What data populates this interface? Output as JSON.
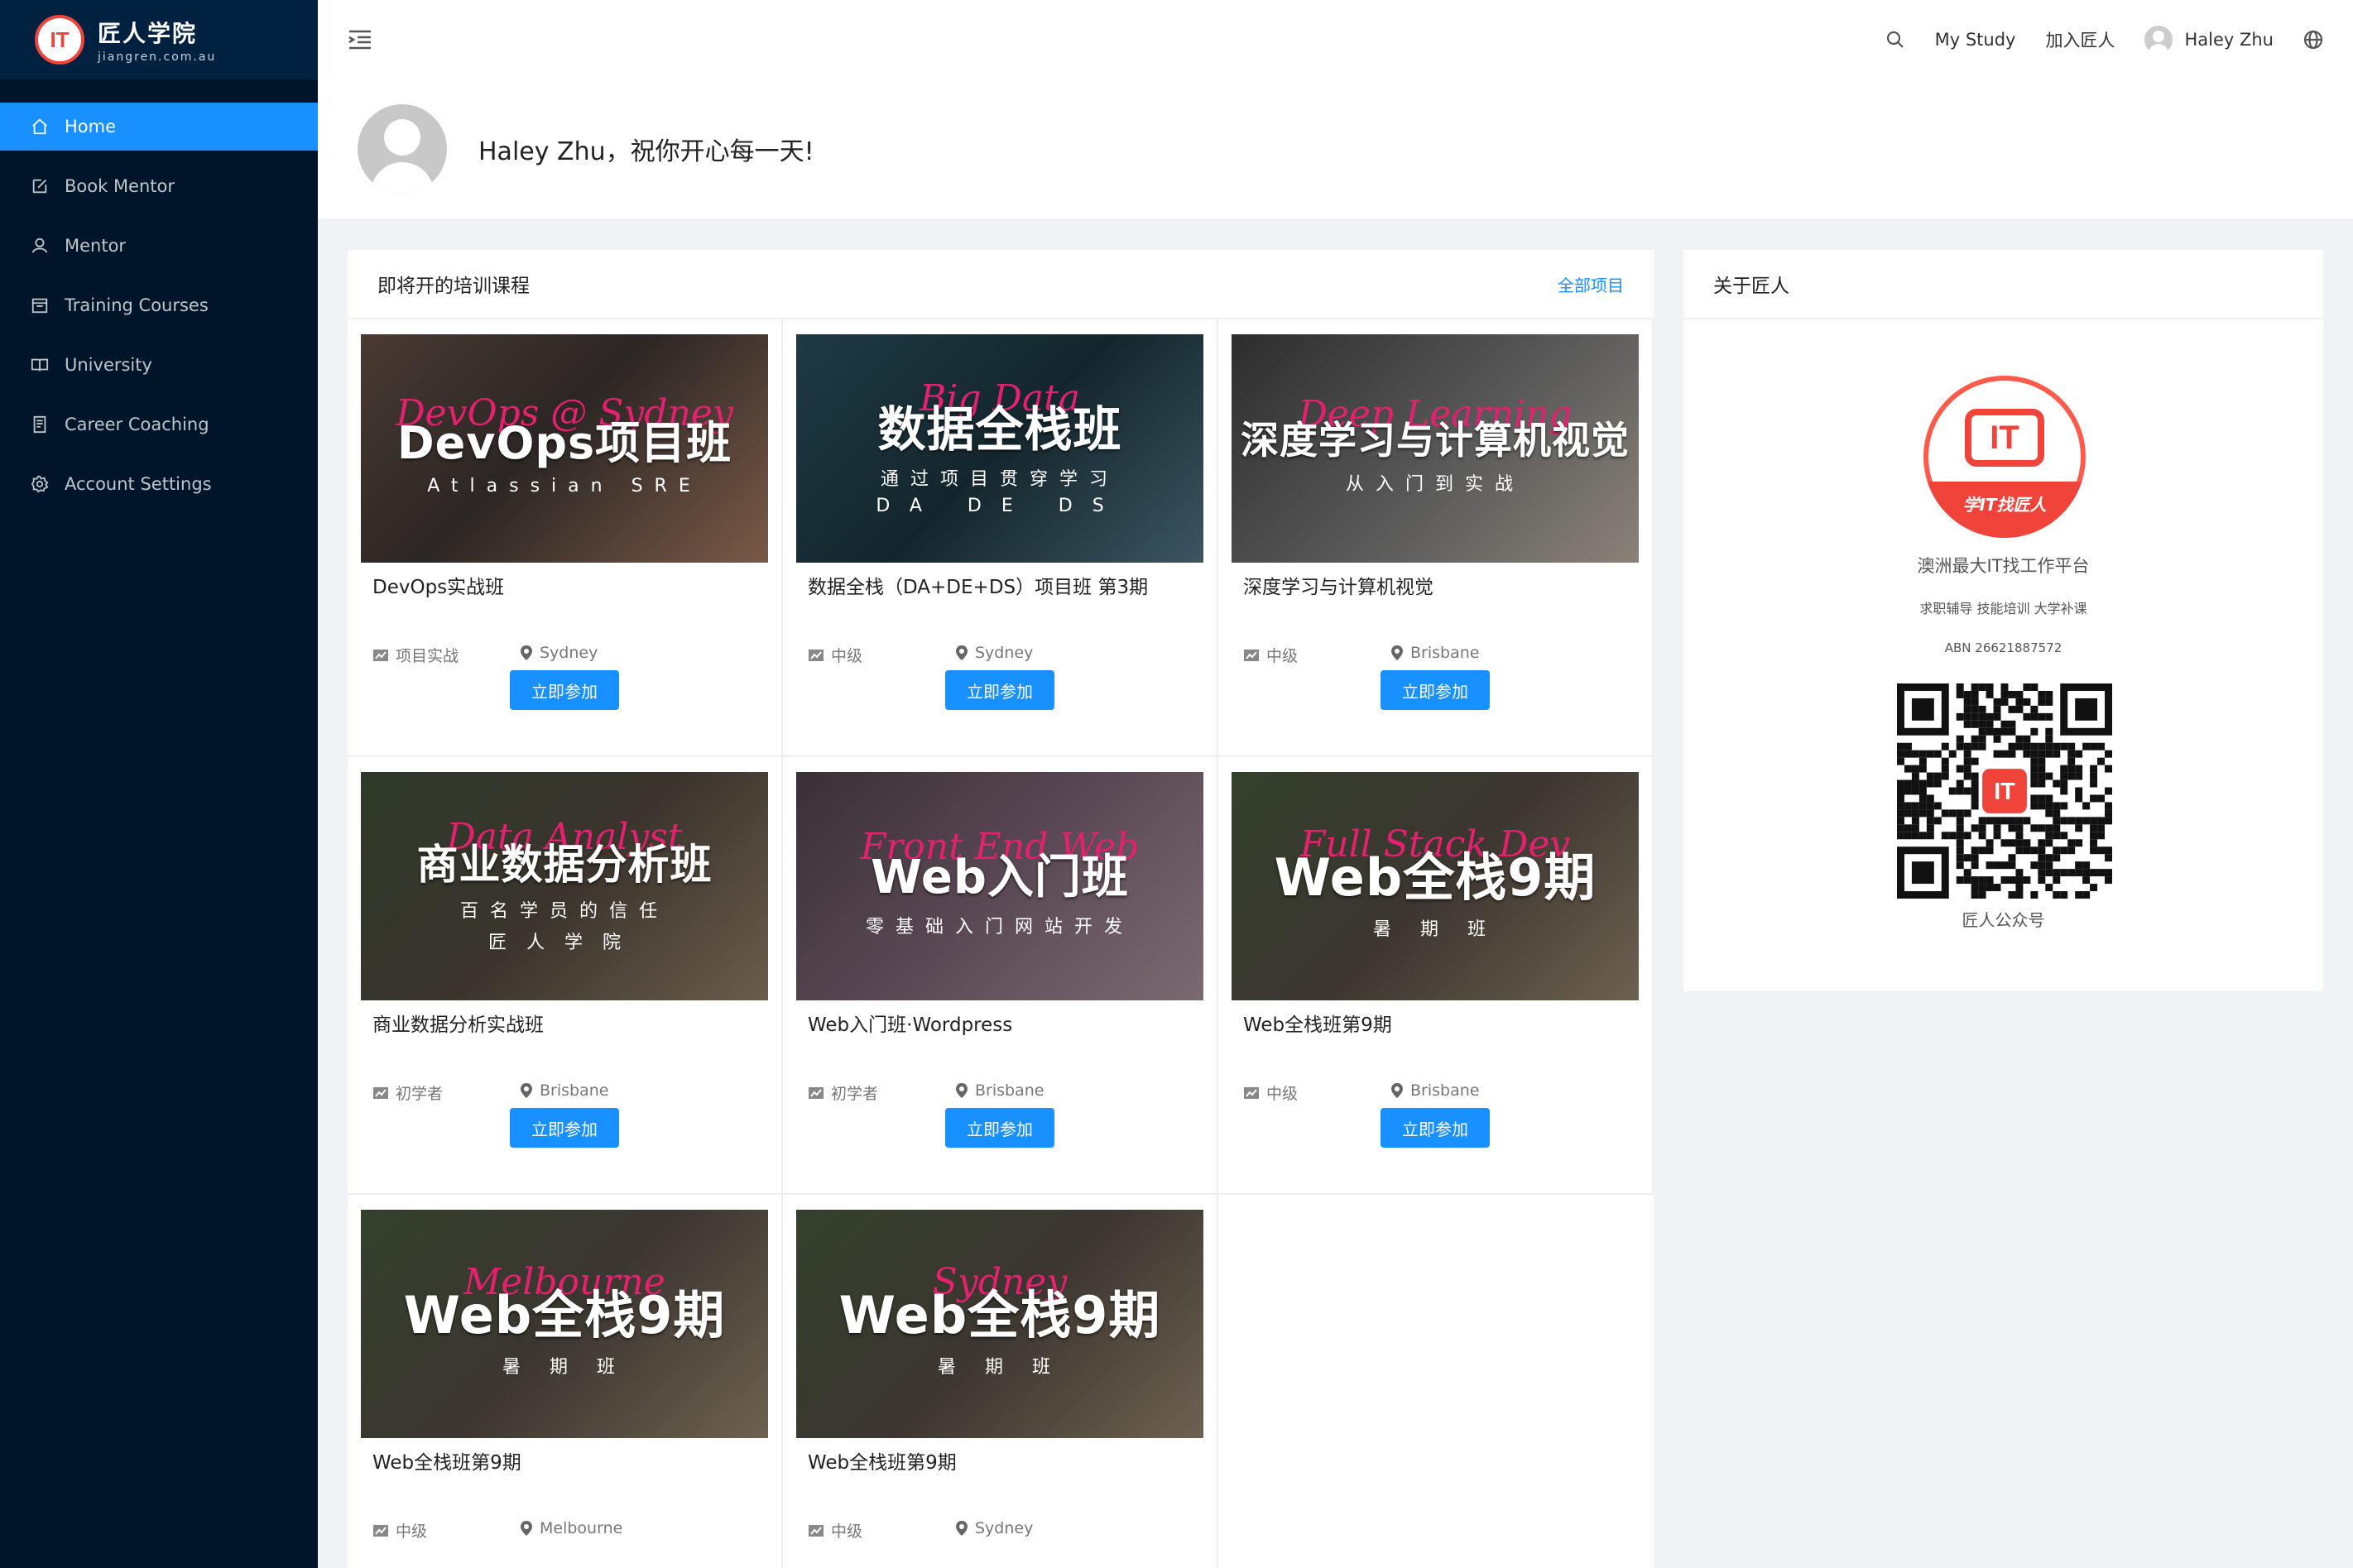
{
  "sidebar": {
    "logo_badge": "IT",
    "logo_title": "匠人学院",
    "logo_sub": "jiangren.com.au",
    "items": [
      {
        "label": "Home",
        "icon": "home-icon",
        "active": true
      },
      {
        "label": "Book Mentor",
        "icon": "edit-icon"
      },
      {
        "label": "Mentor",
        "icon": "user-icon"
      },
      {
        "label": "Training Courses",
        "icon": "calendar-icon"
      },
      {
        "label": "University",
        "icon": "book-icon"
      },
      {
        "label": "Career Coaching",
        "icon": "file-icon"
      },
      {
        "label": "Account Settings",
        "icon": "gear-icon"
      }
    ]
  },
  "header": {
    "my_study": "My Study",
    "join": "加入匠人",
    "user_name": "Haley Zhu"
  },
  "welcome": {
    "text": "Haley Zhu，祝你开心每一天!"
  },
  "courses": {
    "title": "即将开的培训课程",
    "all_link": "全部项目",
    "join_label": "立即参加",
    "items": [
      {
        "title": "DevOps实战班",
        "level": "项目实战",
        "city": "Sydney",
        "img_script": "DevOps @ Sydney",
        "img_big": "DevOps项目班",
        "img_sub": "Atlassian SRE",
        "img_sub2": ""
      },
      {
        "title": "数据全栈（DA+DE+DS）项目班 第3期",
        "level": "中级",
        "city": "Sydney",
        "img_script": "Big Data",
        "img_big": "数据全栈班",
        "img_sub": "通过项目贯穿学习",
        "img_sub2": "DA DE DS"
      },
      {
        "title": "深度学习与计算机视觉",
        "level": "中级",
        "city": "Brisbane",
        "img_script": "Deep Learning",
        "img_big": "深度学习与计算机视觉",
        "img_sub": "从入门到实战",
        "img_sub2": ""
      },
      {
        "title": "商业数据分析实战班",
        "level": "初学者",
        "city": "Brisbane",
        "img_script": "Data Analyst",
        "img_big": "商业数据分析班",
        "img_sub": "百名学员的信任",
        "img_sub2": "匠人学院"
      },
      {
        "title": "Web入门班·Wordpress",
        "level": "初学者",
        "city": "Brisbane",
        "img_script": "Front End Web",
        "img_big": "Web入门班",
        "img_sub": "零基础入门网站开发",
        "img_sub2": ""
      },
      {
        "title": "Web全栈班第9期",
        "level": "中级",
        "city": "Brisbane",
        "img_script": "Full Stack Dev",
        "img_big": "Web全栈9期",
        "img_sub": "暑 期 班",
        "img_sub2": ""
      },
      {
        "title": "Web全栈班第9期",
        "level": "中级",
        "city": "Melbourne",
        "img_script": "Melbourne",
        "img_big": "Web全栈9期",
        "img_sub": "暑 期 班",
        "img_sub2": ""
      },
      {
        "title": "Web全栈班第9期",
        "level": "中级",
        "city": "Sydney",
        "img_script": "Sydney",
        "img_big": "Web全栈9期",
        "img_sub": "暑 期 班",
        "img_sub2": ""
      }
    ]
  },
  "about": {
    "title": "关于匠人",
    "logo_band": "学IT找匠人",
    "logo_mark": "IT",
    "tagline": "澳洲最大IT找工作平台",
    "services": "求职辅导 技能培训 大学补课",
    "abn": "ABN 26621887572",
    "qr_caption": "匠人公众号"
  },
  "colors": {
    "sidebar_bg": "#001529",
    "accent": "#1890ff",
    "brand_red": "#f0433a",
    "script_pink": "#e4206f"
  }
}
